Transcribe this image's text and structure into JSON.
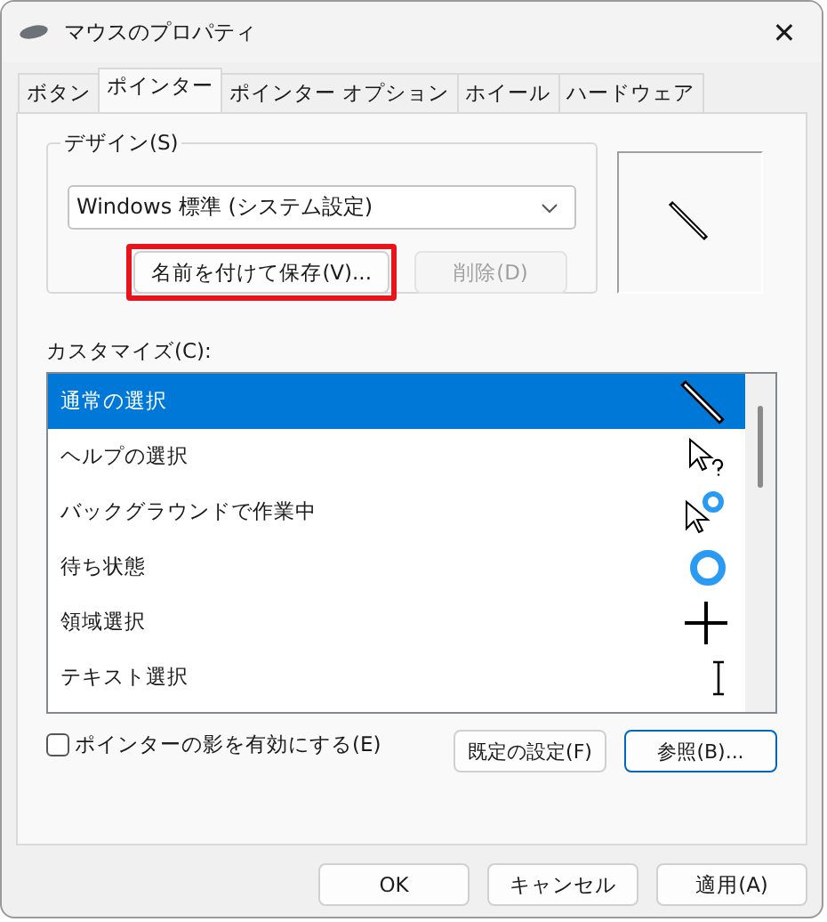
{
  "window": {
    "title": "マウスのプロパティ",
    "close": "✕"
  },
  "tabs": [
    {
      "label": "ボタン",
      "selected": false
    },
    {
      "label": "ポインター",
      "selected": true
    },
    {
      "label": "ポインター オプション",
      "selected": false
    },
    {
      "label": "ホイール",
      "selected": false
    },
    {
      "label": "ハードウェア",
      "selected": false
    }
  ],
  "design": {
    "label": "デザイン(S)",
    "scheme": "Windows 標準 (システム設定)",
    "buttons": [
      {
        "label": "名前を付けて保存(V)...",
        "disabled": false,
        "highlighted": true
      },
      {
        "label": "削除(D)",
        "disabled": true,
        "highlighted": false
      }
    ]
  },
  "customize": {
    "label": "カスタマイズ(C):",
    "rows": [
      {
        "name": "通常の選択",
        "kind": "pen",
        "selected": true
      },
      {
        "name": "ヘルプの選択",
        "kind": "help",
        "selected": false
      },
      {
        "name": "バックグラウンドで作業中",
        "kind": "working",
        "selected": false
      },
      {
        "name": "待ち状態",
        "kind": "busy",
        "selected": false
      },
      {
        "name": "領域選択",
        "kind": "cross",
        "selected": false
      },
      {
        "name": "テキスト選択",
        "kind": "text",
        "selected": false
      }
    ]
  },
  "shadow": {
    "label": "ポインターの影を有効にする(E)",
    "checked": false
  },
  "pointer_buttons": [
    {
      "label": "既定の設定(F)",
      "default": false
    },
    {
      "label": "参照(B)...",
      "default": true
    }
  ],
  "footer_buttons": [
    "OK",
    "キャンセル",
    "適用(A)"
  ]
}
